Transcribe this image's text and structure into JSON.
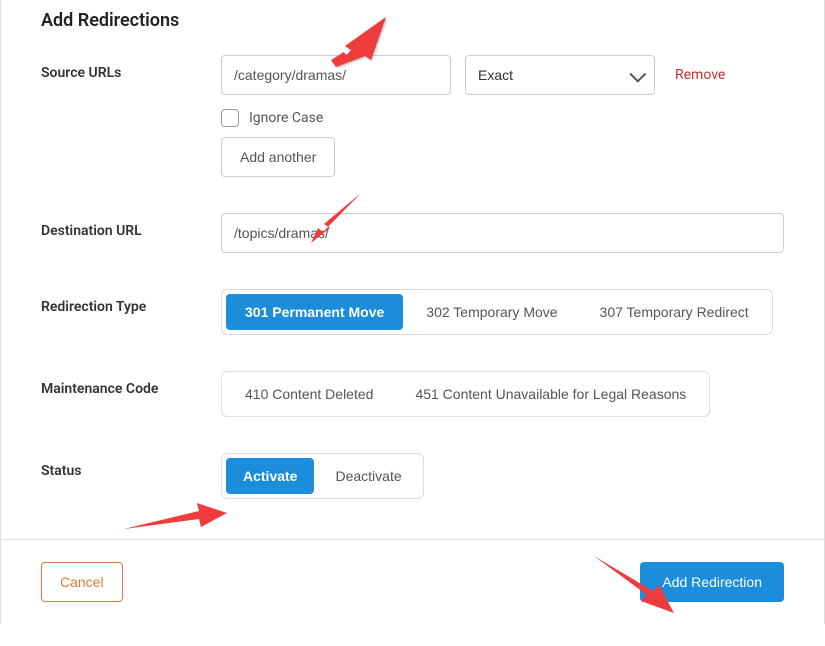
{
  "heading": "Add Redirections",
  "labels": {
    "source_urls": "Source URLs",
    "destination_url": "Destination URL",
    "redirection_type": "Redirection Type",
    "maintenance_code": "Maintenance Code",
    "status": "Status"
  },
  "source": {
    "value": "/category/dramas/",
    "match_options": [
      "Exact"
    ],
    "match_selected": "Exact",
    "remove_label": "Remove",
    "ignore_case_label": "Ignore Case",
    "ignore_case_checked": false,
    "add_another_label": "Add another"
  },
  "destination": {
    "value": "/topics/dramas/"
  },
  "redirection_type": {
    "options": [
      {
        "label": "301 Permanent Move",
        "active": true
      },
      {
        "label": "302 Temporary Move",
        "active": false
      },
      {
        "label": "307 Temporary Redirect",
        "active": false
      }
    ]
  },
  "maintenance_code": {
    "options": [
      {
        "label": "410 Content Deleted",
        "active": false
      },
      {
        "label": "451 Content Unavailable for Legal Reasons",
        "active": false
      }
    ]
  },
  "status": {
    "options": [
      {
        "label": "Activate",
        "active": true
      },
      {
        "label": "Deactivate",
        "active": false
      }
    ]
  },
  "footer": {
    "cancel": "Cancel",
    "submit": "Add Redirection"
  }
}
